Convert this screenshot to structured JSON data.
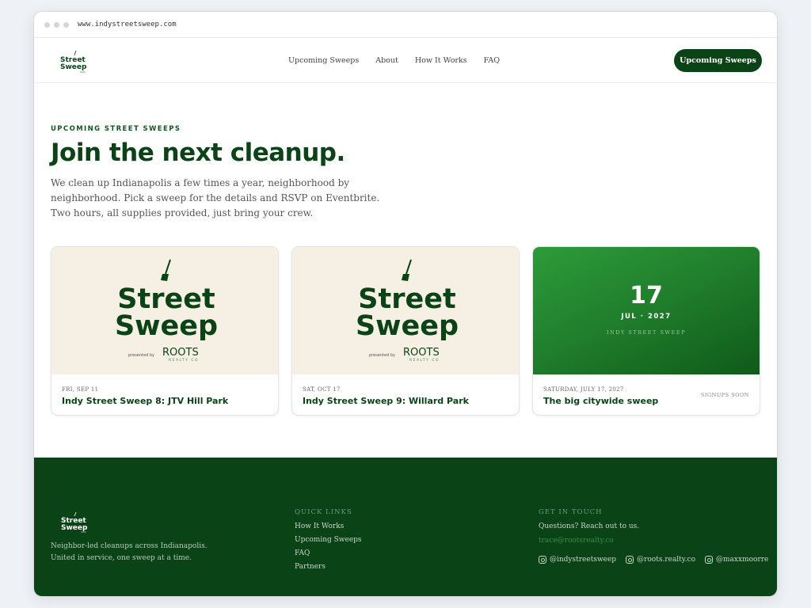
{
  "browser": {
    "url": "www.indystreetsweep.com"
  },
  "nav": {
    "items": [
      "Upcoming Sweeps",
      "About",
      "How It Works",
      "FAQ"
    ],
    "cta": "Upcoming Sweeps"
  },
  "logo": {
    "line1": "Street",
    "line2": "Sweep"
  },
  "hero": {
    "eyebrow": "UPCOMING STREET SWEEPS",
    "title": "Join the next cleanup.",
    "lead": "We clean up Indianapolis a few times a year, neighborhood by neighborhood. Pick a sweep for the details and RSVP on Eventbrite. Two hours, all supplies provided, just bring your crew."
  },
  "art": {
    "line1": "Street",
    "line2": "Sweep",
    "presented_by": "presented by",
    "sponsor": "ROOTS",
    "sponsor_sub": "REALTY CO"
  },
  "cards": [
    {
      "date": "FRI, SEP 11",
      "title": "Indy Street Sweep 8: JTV Hill Park"
    },
    {
      "date": "SAT, OCT 17",
      "title": "Indy Street Sweep 9: Willard Park"
    },
    {
      "date": "SATURDAY, JULY 17, 2027",
      "title": "The big citywide sweep",
      "badge": "SIGNUPS SOON",
      "day": "17",
      "month_year": "JUL · 2027",
      "tag": "INDY STREET SWEEP"
    }
  ],
  "footer": {
    "tagline_1": "Neighbor-led cleanups across Indianapolis.",
    "tagline_2": "United in service, one sweep at a time.",
    "quick_links_heading": "QUICK LINKS",
    "quick_links": [
      "How It Works",
      "Upcoming Sweeps",
      "FAQ",
      "Partners"
    ],
    "contact_heading": "GET IN TOUCH",
    "contact_text": "Questions? Reach out to us.",
    "email": "trace@rootsrealty.co",
    "socials": [
      "@indystreetsweep",
      "@roots.realty.co",
      "@maxxmoorre"
    ]
  },
  "colors": {
    "brand_green": "#0a4416",
    "accent_green": "#2d9b3a",
    "card_cream": "#f6efe3"
  }
}
